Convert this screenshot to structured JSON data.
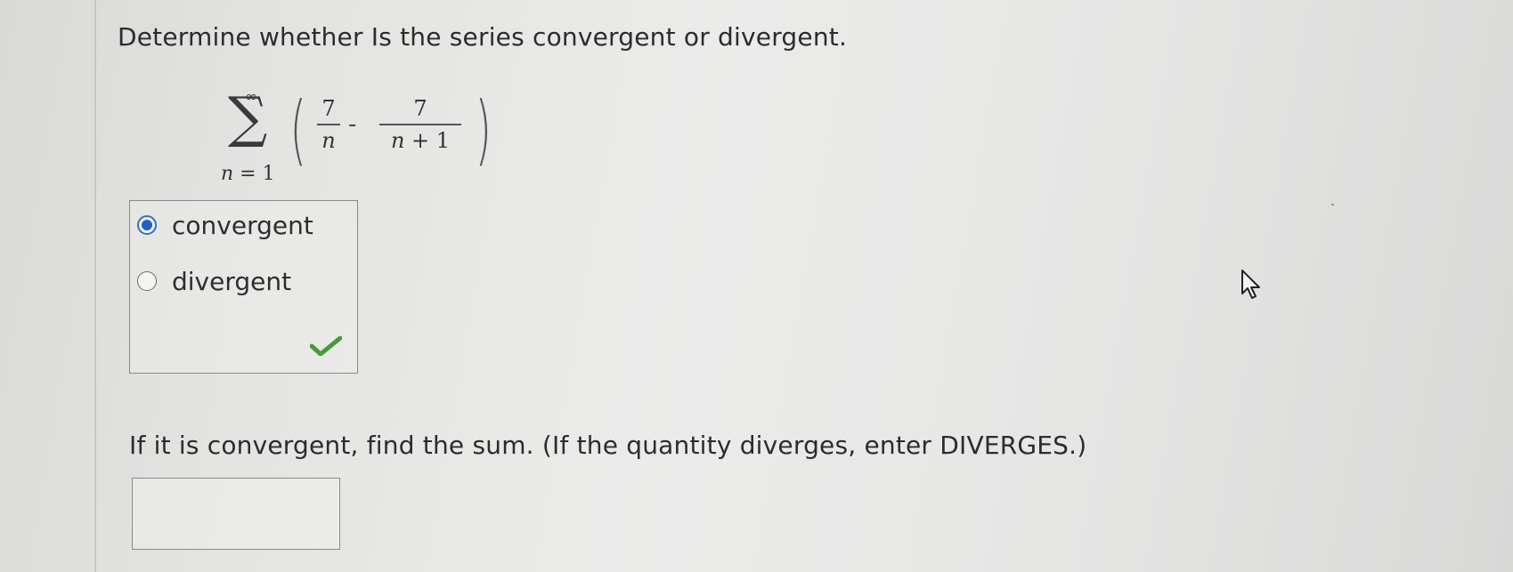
{
  "question": {
    "text": "Determine whether Is the series convergent or divergent."
  },
  "series": {
    "upper_limit": "∞",
    "sigma": "∑",
    "index_var": "n",
    "index_eq": " = 1",
    "term1_numerator": "7",
    "term1_denominator": "n",
    "operator": "-",
    "term2_numerator": "7",
    "term2_denominator_var": "n",
    "term2_denominator_rest": " + 1"
  },
  "choices": {
    "options": [
      {
        "label": "convergent",
        "selected": true
      },
      {
        "label": "divergent",
        "selected": false
      }
    ],
    "feedback_icon": "check-icon",
    "feedback_color": "#4a9a3a"
  },
  "sum_prompt": {
    "text": "If it is convergent, find the sum. (If the quantity diverges, enter DIVERGES.)",
    "input_value": ""
  },
  "colors": {
    "radio_selected": "#1f5fc8"
  }
}
